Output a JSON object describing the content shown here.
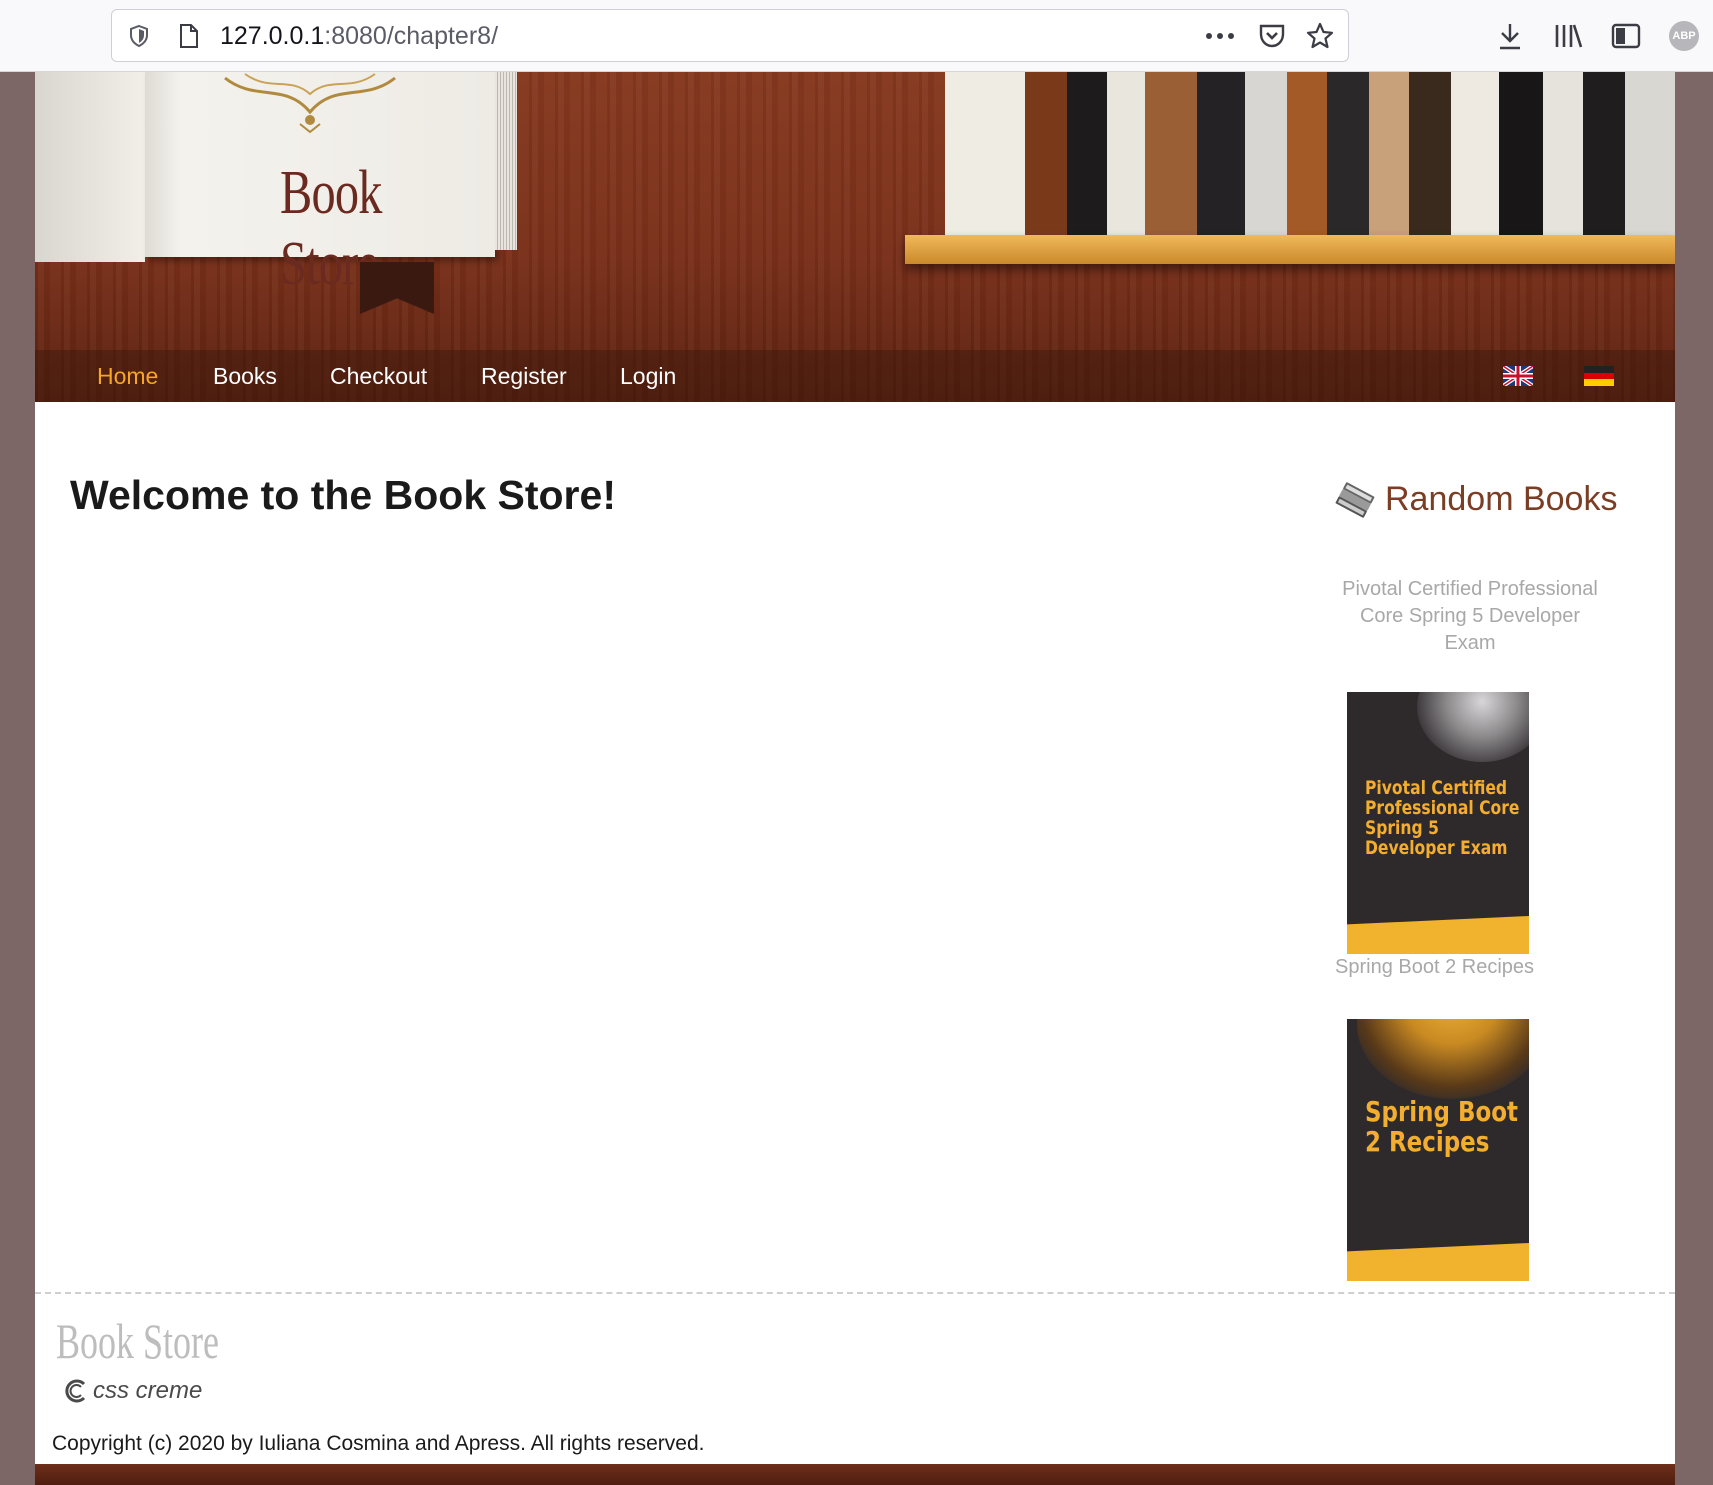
{
  "browser": {
    "url_host": "127.0.0.1",
    "url_rest": ":8080/chapter8/",
    "icons": [
      "shield-icon",
      "page-icon",
      "more-icon",
      "pocket-icon",
      "star-icon",
      "download-icon",
      "library-icon",
      "sidebar-icon",
      "adblock-icon"
    ],
    "adblock_label": "ABP"
  },
  "header": {
    "logo_text": "Book Store"
  },
  "nav": {
    "items": [
      {
        "label": "Home",
        "active": true
      },
      {
        "label": "Books",
        "active": false
      },
      {
        "label": "Checkout",
        "active": false
      },
      {
        "label": "Register",
        "active": false
      },
      {
        "label": "Login",
        "active": false
      }
    ],
    "flags": [
      "english-flag-icon",
      "german-flag-icon"
    ]
  },
  "main": {
    "heading": "Welcome to the Book Store!"
  },
  "sidebar": {
    "title": "Random Books",
    "books": [
      {
        "caption": "Pivotal Certified Professional Core Spring 5 Developer Exam",
        "cover_title": "Pivotal Certified Professional Core Spring 5 Developer Exam"
      },
      {
        "caption": "Spring Boot 2 Recipes",
        "cover_title": "Spring Boot 2 Recipes"
      }
    ]
  },
  "footer": {
    "logo_text": "Book Store",
    "credit": "css creme",
    "copyright": "Copyright (c) 2020 by Iuliana Cosmina and Apress. All rights reserved."
  },
  "colors": {
    "nav_active": "#f5a623",
    "sidebar_title": "#7c3d25",
    "caption": "#a8a8a8",
    "cover_accent": "#f1b22e"
  }
}
